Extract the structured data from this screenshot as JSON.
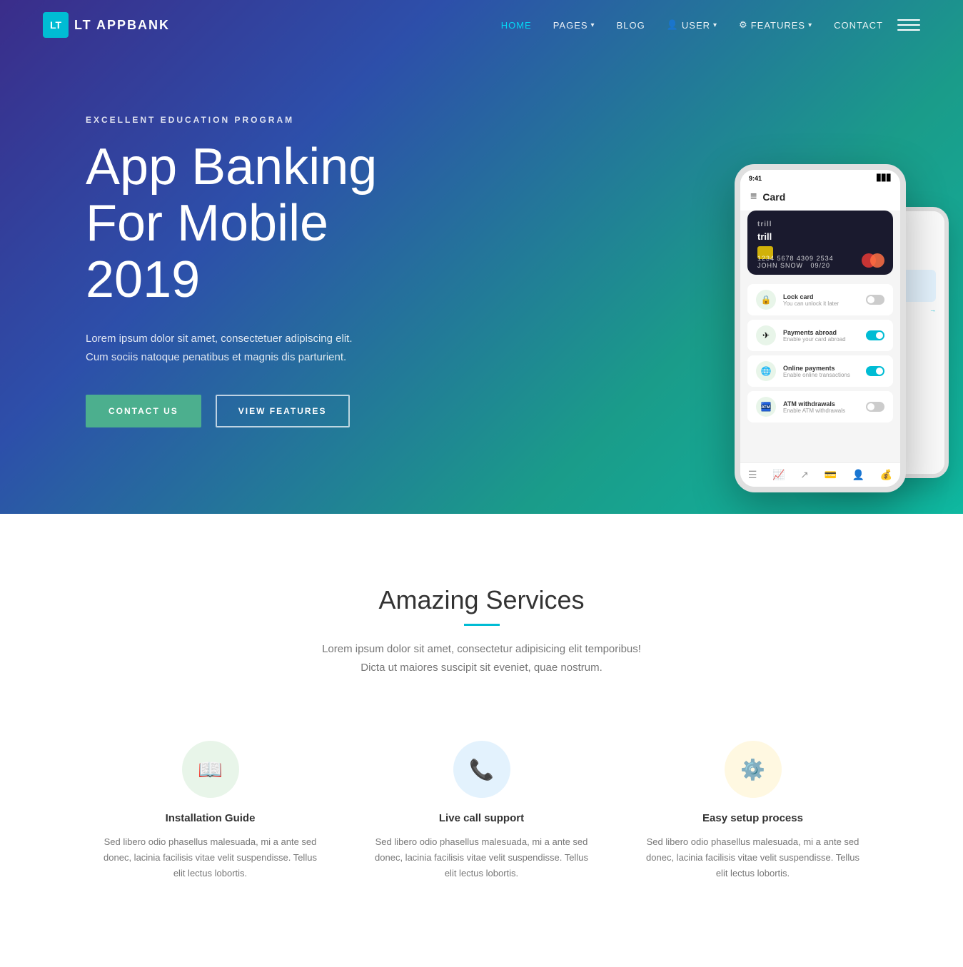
{
  "nav": {
    "logo_icon": "LT",
    "logo_text": "LT APPBANK",
    "links": [
      {
        "id": "home",
        "label": "HOME",
        "active": true,
        "has_dropdown": false
      },
      {
        "id": "pages",
        "label": "PAGES",
        "active": false,
        "has_dropdown": true
      },
      {
        "id": "blog",
        "label": "BLOG",
        "active": false,
        "has_dropdown": false
      },
      {
        "id": "user",
        "label": "USER",
        "active": false,
        "has_dropdown": true
      },
      {
        "id": "features",
        "label": "FEATURES",
        "active": false,
        "has_dropdown": true
      },
      {
        "id": "contact",
        "label": "CONTACT",
        "active": false,
        "has_dropdown": false
      }
    ]
  },
  "hero": {
    "subtitle": "EXCELLENT EDUCATION PROGRAM",
    "title_line1": "App Banking",
    "title_line2": "For Mobile 2019",
    "description_line1": "Lorem ipsum dolor sit amet, consectetuer adipiscing elit.",
    "description_line2": "Cum sociis natoque penatibus et magnis dis parturient.",
    "btn_contact": "CONTACT US",
    "btn_features": "VIEW FEATURES"
  },
  "phone": {
    "time": "9:41",
    "card_title": "Card",
    "card_brand": "trill",
    "card_number": "1234 5678 4309 2534",
    "card_holder": "JOHN SNOW",
    "card_expiry": "09/20",
    "list_items": [
      {
        "icon": "🔒",
        "label": "Lock card",
        "sub": "You can unlock it later",
        "toggle": false
      },
      {
        "icon": "✈️",
        "label": "Payments abroad",
        "sub": "Enable your card abroad",
        "toggle": true
      },
      {
        "icon": "🌐",
        "label": "Online payments",
        "sub": "Enable online transactions",
        "toggle": true
      },
      {
        "icon": "🏧",
        "label": "ATM withdrawals",
        "sub": "Enable ATM withdrawals",
        "toggle": false
      }
    ]
  },
  "services": {
    "title": "Amazing Services",
    "description_line1": "Lorem ipsum dolor sit amet, consectetur adipisicing elit temporibus!",
    "description_line2": "Dicta ut maiores suscipit sit eveniet, quae nostrum.",
    "cards": [
      {
        "id": "installation",
        "icon": "📖",
        "name": "Installation Guide",
        "text": "Sed libero odio phasellus malesuada, mi a ante sed donec, lacinia facilisis vitae velit suspendisse. Tellus elit lectus lobortis."
      },
      {
        "id": "support",
        "icon": "📞",
        "name": "Live call support",
        "text": "Sed libero odio phasellus malesuada, mi a ante sed donec, lacinia facilisis vitae velit suspendisse. Tellus elit lectus lobortis."
      },
      {
        "id": "setup",
        "icon": "⚙️",
        "name": "Easy setup process",
        "text": "Sed libero odio phasellus malesuada, mi a ante sed donec, lacinia facilisis vitae velit suspendisse. Tellus elit lectus lobortis."
      }
    ]
  },
  "colors": {
    "accent_teal": "#00bcd4",
    "accent_green": "#4caf8e",
    "hero_purple": "#3a2d8a",
    "hero_teal": "#0fb8a0"
  }
}
